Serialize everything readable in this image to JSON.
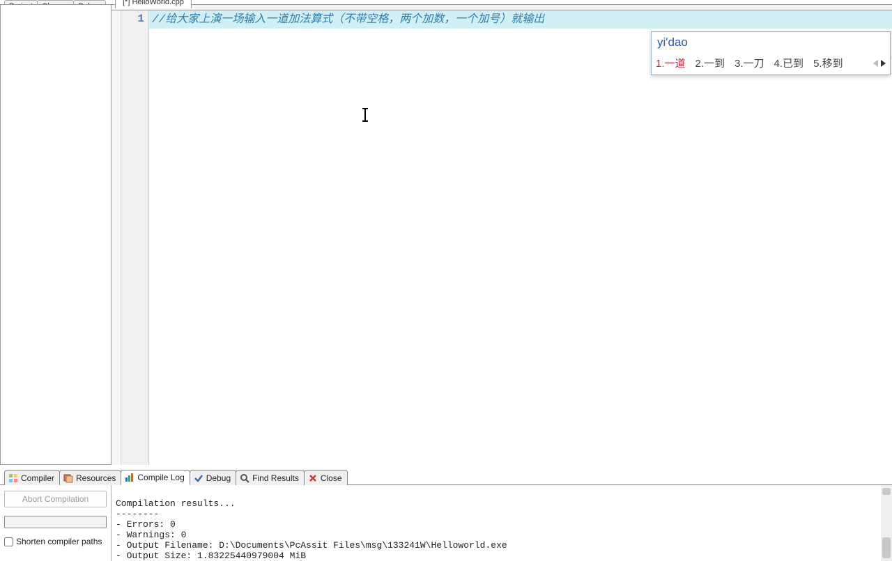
{
  "left_top_tabs": {
    "project": "Project",
    "classes": "Classes",
    "debug": "Debug"
  },
  "file_tab": "[*] HelloWorld.cpp",
  "gutter": {
    "line1": "1"
  },
  "code": {
    "line1": "//给大家上演一场输入一道加法算式（不带空格，两个加数，一个加号）就输出"
  },
  "ime": {
    "input": "yi'dao",
    "candidates": [
      "1.一道",
      "2.一到",
      "3.一刀",
      "4.已到",
      "5.移到"
    ]
  },
  "bottom_tabs": {
    "compiler": "Compiler",
    "resources": "Resources",
    "compile_log": "Compile Log",
    "debug": "Debug",
    "find_results": "Find Results",
    "close": "Close"
  },
  "bottom_left": {
    "abort": "Abort Compilation",
    "shorten": "Shorten compiler paths"
  },
  "log_lines": [
    "Compilation results...",
    "--------",
    "- Errors: 0",
    "- Warnings: 0",
    "- Output Filename: D:\\Documents\\PcAssit Files\\msg\\133241W\\Helloworld.exe",
    "- Output Size: 1.83225440979004 MiB"
  ]
}
